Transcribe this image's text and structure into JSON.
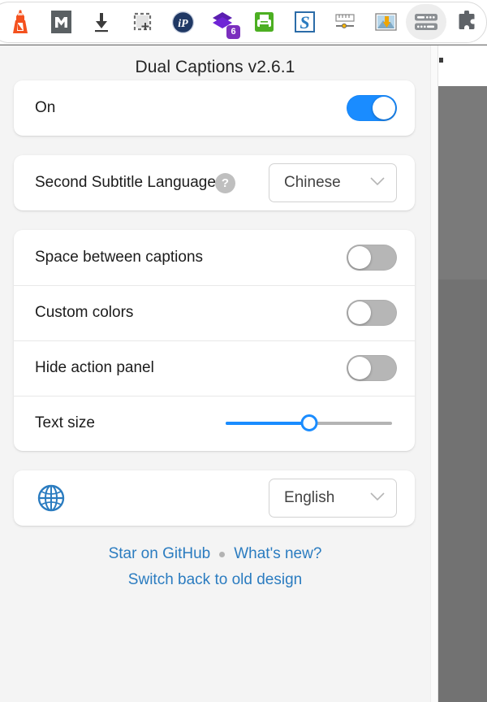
{
  "browser_toolbar": {
    "icons": [
      {
        "name": "lighthouse-icon",
        "label": "Lighthouse"
      },
      {
        "name": "markdown-icon",
        "label": "Markdown"
      },
      {
        "name": "download-icon",
        "label": "Download"
      },
      {
        "name": "screenshot-capture-icon",
        "label": "Capture"
      },
      {
        "name": "ip-lookup-icon",
        "label": "IP"
      },
      {
        "name": "purple-stack-icon",
        "label": "Stack",
        "badge": "6"
      },
      {
        "name": "print-green-icon",
        "label": "Print"
      },
      {
        "name": "s-letter-icon",
        "label": "S"
      },
      {
        "name": "ruler-slider-icon",
        "label": "Measure"
      },
      {
        "name": "image-save-icon",
        "label": "Save image"
      },
      {
        "name": "dual-captions-icon",
        "label": "Dual Captions",
        "active": true
      },
      {
        "name": "extensions-puzzle-icon",
        "label": "Extensions"
      }
    ]
  },
  "popup": {
    "title": "Dual Captions v2.6.1",
    "power": {
      "label": "On",
      "enabled": true
    },
    "language": {
      "label": "Second Subtitle Language",
      "help": "?",
      "selected": "Chinese"
    },
    "settings": [
      {
        "label": "Space between captions",
        "type": "toggle",
        "enabled": false
      },
      {
        "label": "Custom colors",
        "type": "toggle",
        "enabled": false
      },
      {
        "label": "Hide action panel",
        "type": "toggle",
        "enabled": false
      },
      {
        "label": "Text size",
        "type": "slider",
        "value": 50
      }
    ],
    "ui_language": {
      "icon": "globe-icon",
      "selected": "English"
    },
    "footer": {
      "github_link": "Star on GitHub",
      "separator": "•",
      "whats_new_link": "What's new?",
      "switch_design_link": "Switch back to old design"
    }
  },
  "colors": {
    "accent_blue": "#1a8cff",
    "link_blue": "#2b7cc0",
    "toggle_off_gray": "#b6b6b6",
    "popup_background": "#f4f4f4",
    "card_white": "#ffffff",
    "page_backdrop_gray": "#7a7a7a"
  }
}
